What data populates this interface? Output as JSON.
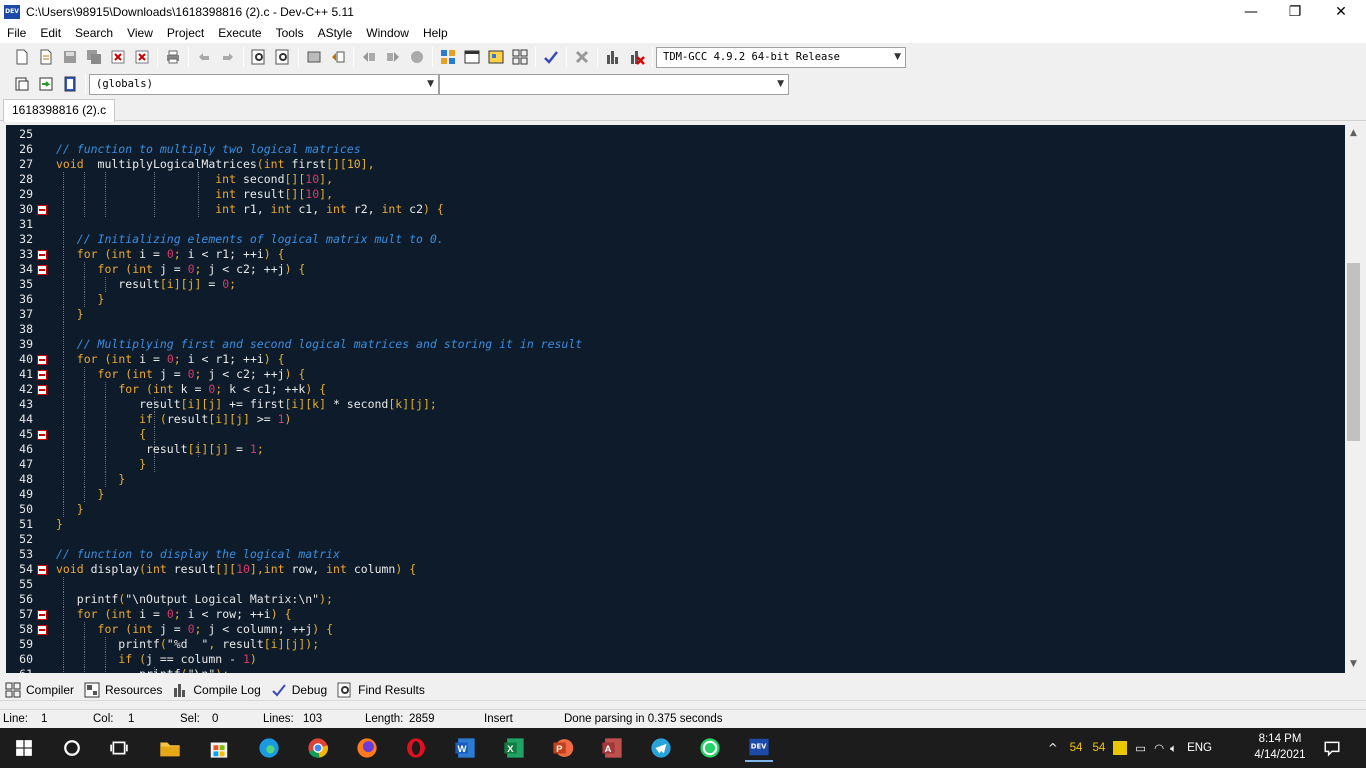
{
  "window": {
    "title": "C:\\Users\\98915\\Downloads\\1618398816 (2).c - Dev-C++ 5.11",
    "minimize": "—",
    "maximize": "❐",
    "close": "✕",
    "app_icon": "DEV"
  },
  "menu": [
    "File",
    "Edit",
    "Search",
    "View",
    "Project",
    "Execute",
    "Tools",
    "AStyle",
    "Window",
    "Help"
  ],
  "toolbar": {
    "compiler": "TDM-GCC 4.9.2 64-bit Release",
    "scope": "(globals)",
    "member": ""
  },
  "file_tab": "1618398816 (2).c",
  "editor": {
    "lines": [
      {
        "n": "25",
        "f": false,
        "g": [],
        "t": []
      },
      {
        "n": "26",
        "f": false,
        "g": [],
        "t": [
          [
            "c",
            "// function to multiply two logical matrices"
          ]
        ]
      },
      {
        "n": "27",
        "f": false,
        "g": [],
        "t": [
          [
            "k",
            "void"
          ],
          [
            "",
            "  multiplyLogicalMatrices"
          ],
          [
            "p",
            "("
          ],
          [
            "k",
            "int"
          ],
          [
            "",
            " first"
          ],
          [
            "p",
            "[][10],"
          ]
        ]
      },
      {
        "n": "28",
        "f": false,
        "g": [
          1,
          2,
          3,
          4,
          5
        ],
        "t": [
          [
            "",
            "                       "
          ],
          [
            "k",
            "int"
          ],
          [
            "",
            " second"
          ],
          [
            "p",
            "[]["
          ],
          [
            "n",
            "10"
          ],
          [
            "p",
            "],"
          ]
        ]
      },
      {
        "n": "29",
        "f": false,
        "g": [
          1,
          2,
          3,
          4,
          5
        ],
        "t": [
          [
            "",
            "                       "
          ],
          [
            "k",
            "int"
          ],
          [
            "",
            " result"
          ],
          [
            "p",
            "[]["
          ],
          [
            "n",
            "10"
          ],
          [
            "p",
            "],"
          ]
        ]
      },
      {
        "n": "30",
        "f": true,
        "g": [
          1,
          2,
          3,
          4,
          5
        ],
        "t": [
          [
            "",
            "                       "
          ],
          [
            "k",
            "int"
          ],
          [
            "",
            " r1, "
          ],
          [
            "k",
            "int"
          ],
          [
            "",
            " c1, "
          ],
          [
            "k",
            "int"
          ],
          [
            "",
            " r2, "
          ],
          [
            "k",
            "int"
          ],
          [
            "",
            " c2"
          ],
          [
            "p",
            ") {"
          ]
        ]
      },
      {
        "n": "31",
        "f": false,
        "g": [
          1
        ],
        "t": []
      },
      {
        "n": "32",
        "f": false,
        "g": [
          1
        ],
        "t": [
          [
            "",
            "   "
          ],
          [
            "c",
            "// Initializing elements of logical matrix mult to 0."
          ]
        ]
      },
      {
        "n": "33",
        "f": true,
        "g": [
          1
        ],
        "t": [
          [
            "",
            "   "
          ],
          [
            "k",
            "for"
          ],
          [
            "p",
            " ("
          ],
          [
            "k",
            "int"
          ],
          [
            "",
            " i = "
          ],
          [
            "n",
            "0"
          ],
          [
            "p",
            ";"
          ],
          [
            "",
            " i < r1; ++i"
          ],
          [
            "p",
            ") {"
          ]
        ]
      },
      {
        "n": "34",
        "f": true,
        "g": [
          1,
          2
        ],
        "t": [
          [
            "",
            "      "
          ],
          [
            "k",
            "for"
          ],
          [
            "p",
            " ("
          ],
          [
            "k",
            "int"
          ],
          [
            "",
            " j = "
          ],
          [
            "n",
            "0"
          ],
          [
            "p",
            ";"
          ],
          [
            "",
            " j < c2; ++j"
          ],
          [
            "p",
            ") {"
          ]
        ]
      },
      {
        "n": "35",
        "f": false,
        "g": [
          1,
          2,
          3
        ],
        "t": [
          [
            "",
            "         result"
          ],
          [
            "p",
            "[i][j]"
          ],
          [
            "",
            " = "
          ],
          [
            "n",
            "0"
          ],
          [
            "p",
            ";"
          ]
        ]
      },
      {
        "n": "36",
        "f": false,
        "g": [
          1,
          2
        ],
        "t": [
          [
            "",
            "      "
          ],
          [
            "p",
            "}"
          ]
        ]
      },
      {
        "n": "37",
        "f": false,
        "g": [
          1
        ],
        "t": [
          [
            "",
            "   "
          ],
          [
            "p",
            "}"
          ]
        ]
      },
      {
        "n": "38",
        "f": false,
        "g": [
          1
        ],
        "t": []
      },
      {
        "n": "39",
        "f": false,
        "g": [
          1
        ],
        "t": [
          [
            "",
            "   "
          ],
          [
            "c",
            "// Multiplying first and second logical matrices and storing it in result"
          ]
        ]
      },
      {
        "n": "40",
        "f": true,
        "g": [
          1
        ],
        "t": [
          [
            "",
            "   "
          ],
          [
            "k",
            "for"
          ],
          [
            "p",
            " ("
          ],
          [
            "k",
            "int"
          ],
          [
            "",
            " i = "
          ],
          [
            "n",
            "0"
          ],
          [
            "p",
            ";"
          ],
          [
            "",
            " i < r1; ++i"
          ],
          [
            "p",
            ") {"
          ]
        ]
      },
      {
        "n": "41",
        "f": true,
        "g": [
          1,
          2
        ],
        "t": [
          [
            "",
            "      "
          ],
          [
            "k",
            "for"
          ],
          [
            "p",
            " ("
          ],
          [
            "k",
            "int"
          ],
          [
            "",
            " j = "
          ],
          [
            "n",
            "0"
          ],
          [
            "p",
            ";"
          ],
          [
            "",
            " j < c2; ++j"
          ],
          [
            "p",
            ") {"
          ]
        ]
      },
      {
        "n": "42",
        "f": true,
        "g": [
          1,
          2,
          3
        ],
        "t": [
          [
            "",
            "         "
          ],
          [
            "k",
            "for"
          ],
          [
            "p",
            " ("
          ],
          [
            "k",
            "int"
          ],
          [
            "",
            " k = "
          ],
          [
            "n",
            "0"
          ],
          [
            "p",
            ";"
          ],
          [
            "",
            " k < c1; ++k"
          ],
          [
            "p",
            ") {"
          ]
        ]
      },
      {
        "n": "43",
        "f": false,
        "g": [
          1,
          2,
          3,
          4
        ],
        "t": [
          [
            "",
            "            result"
          ],
          [
            "p",
            "[i][j]"
          ],
          [
            "",
            " += first"
          ],
          [
            "p",
            "[i][k]"
          ],
          [
            "",
            " * second"
          ],
          [
            "p",
            "[k][j];"
          ]
        ]
      },
      {
        "n": "44",
        "f": false,
        "g": [
          1,
          2,
          3,
          4
        ],
        "t": [
          [
            "",
            "            "
          ],
          [
            "k",
            "if"
          ],
          [
            "p",
            " ("
          ],
          [
            "",
            "result"
          ],
          [
            "p",
            "[i][j]"
          ],
          [
            "",
            " >= "
          ],
          [
            "n",
            "1"
          ],
          [
            "p",
            ")"
          ]
        ]
      },
      {
        "n": "45",
        "f": true,
        "g": [
          1,
          2,
          3,
          4
        ],
        "t": [
          [
            "",
            "            "
          ],
          [
            "p",
            "{"
          ]
        ]
      },
      {
        "n": "46",
        "f": false,
        "g": [
          1,
          2,
          3,
          4,
          5
        ],
        "t": [
          [
            "",
            "             result"
          ],
          [
            "p",
            "[i][j]"
          ],
          [
            "",
            " = "
          ],
          [
            "n",
            "1"
          ],
          [
            "p",
            ";"
          ]
        ]
      },
      {
        "n": "47",
        "f": false,
        "g": [
          1,
          2,
          3,
          4
        ],
        "t": [
          [
            "",
            "            "
          ],
          [
            "p",
            "}"
          ]
        ]
      },
      {
        "n": "48",
        "f": false,
        "g": [
          1,
          2,
          3
        ],
        "t": [
          [
            "",
            "         "
          ],
          [
            "p",
            "}"
          ]
        ]
      },
      {
        "n": "49",
        "f": false,
        "g": [
          1,
          2
        ],
        "t": [
          [
            "",
            "      "
          ],
          [
            "p",
            "}"
          ]
        ]
      },
      {
        "n": "50",
        "f": false,
        "g": [
          1
        ],
        "t": [
          [
            "",
            "   "
          ],
          [
            "p",
            "}"
          ]
        ]
      },
      {
        "n": "51",
        "f": false,
        "g": [],
        "t": [
          [
            "p",
            "}"
          ]
        ]
      },
      {
        "n": "52",
        "f": false,
        "g": [],
        "t": []
      },
      {
        "n": "53",
        "f": false,
        "g": [],
        "t": [
          [
            "c",
            "// function to display the logical matrix"
          ]
        ]
      },
      {
        "n": "54",
        "f": true,
        "g": [],
        "t": [
          [
            "k",
            "void"
          ],
          [
            "",
            " display"
          ],
          [
            "p",
            "("
          ],
          [
            "k",
            "int"
          ],
          [
            "",
            " result"
          ],
          [
            "p",
            "[]["
          ],
          [
            "n",
            "10"
          ],
          [
            "p",
            "],"
          ],
          [
            " ",
            ""
          ],
          [
            "k",
            "int"
          ],
          [
            "",
            " row, "
          ],
          [
            "k",
            "int"
          ],
          [
            "",
            " column"
          ],
          [
            "p",
            ") {"
          ]
        ]
      },
      {
        "n": "55",
        "f": false,
        "g": [
          1
        ],
        "t": []
      },
      {
        "n": "56",
        "f": false,
        "g": [
          1
        ],
        "t": [
          [
            "",
            "   printf"
          ],
          [
            "p",
            "("
          ],
          [
            "st",
            "\"\\nOutput Logical Matrix:\\n\""
          ],
          [
            "p",
            ");"
          ]
        ]
      },
      {
        "n": "57",
        "f": true,
        "g": [
          1
        ],
        "t": [
          [
            "",
            "   "
          ],
          [
            "k",
            "for"
          ],
          [
            "p",
            " ("
          ],
          [
            "k",
            "int"
          ],
          [
            "",
            " i = "
          ],
          [
            "n",
            "0"
          ],
          [
            "p",
            ";"
          ],
          [
            "",
            " i < row; ++i"
          ],
          [
            "p",
            ") {"
          ]
        ]
      },
      {
        "n": "58",
        "f": true,
        "g": [
          1,
          2
        ],
        "t": [
          [
            "",
            "      "
          ],
          [
            "k",
            "for"
          ],
          [
            "p",
            " ("
          ],
          [
            "k",
            "int"
          ],
          [
            "",
            " j = "
          ],
          [
            "n",
            "0"
          ],
          [
            "p",
            ";"
          ],
          [
            "",
            " j < column; ++j"
          ],
          [
            "p",
            ") {"
          ]
        ]
      },
      {
        "n": "59",
        "f": false,
        "g": [
          1,
          2,
          3
        ],
        "t": [
          [
            "",
            "         printf"
          ],
          [
            "p",
            "("
          ],
          [
            "st",
            "\"%d  \""
          ],
          [
            "p",
            ","
          ],
          [
            "",
            " result"
          ],
          [
            "p",
            "[i][j]);"
          ]
        ]
      },
      {
        "n": "60",
        "f": false,
        "g": [
          1,
          2,
          3
        ],
        "t": [
          [
            "",
            "         "
          ],
          [
            "k",
            "if"
          ],
          [
            "p",
            " ("
          ],
          [
            "",
            "j == column - "
          ],
          [
            "n",
            "1"
          ],
          [
            "p",
            ")"
          ]
        ]
      },
      {
        "n": "61",
        "f": false,
        "g": [
          1,
          2,
          3,
          4
        ],
        "t": [
          [
            "",
            "            printf"
          ],
          [
            "p",
            "("
          ],
          [
            "st",
            "\"\\n\""
          ],
          [
            "p",
            ");"
          ]
        ]
      }
    ]
  },
  "bottom_tabs": [
    "Compiler",
    "Resources",
    "Compile Log",
    "Debug",
    "Find Results"
  ],
  "status": {
    "line_label": "Line:",
    "line": "1",
    "col_label": "Col:",
    "col": "1",
    "sel_label": "Sel:",
    "sel": "0",
    "lines_label": "Lines:",
    "lines": "103",
    "length_label": "Length:",
    "length": "2859",
    "mode": "Insert",
    "message": "Done parsing in 0.375 seconds"
  },
  "taskbar": {
    "tray_a": "54",
    "tray_b": "54",
    "lang": "ENG",
    "time": "8:14 PM",
    "date": "4/14/2021"
  }
}
